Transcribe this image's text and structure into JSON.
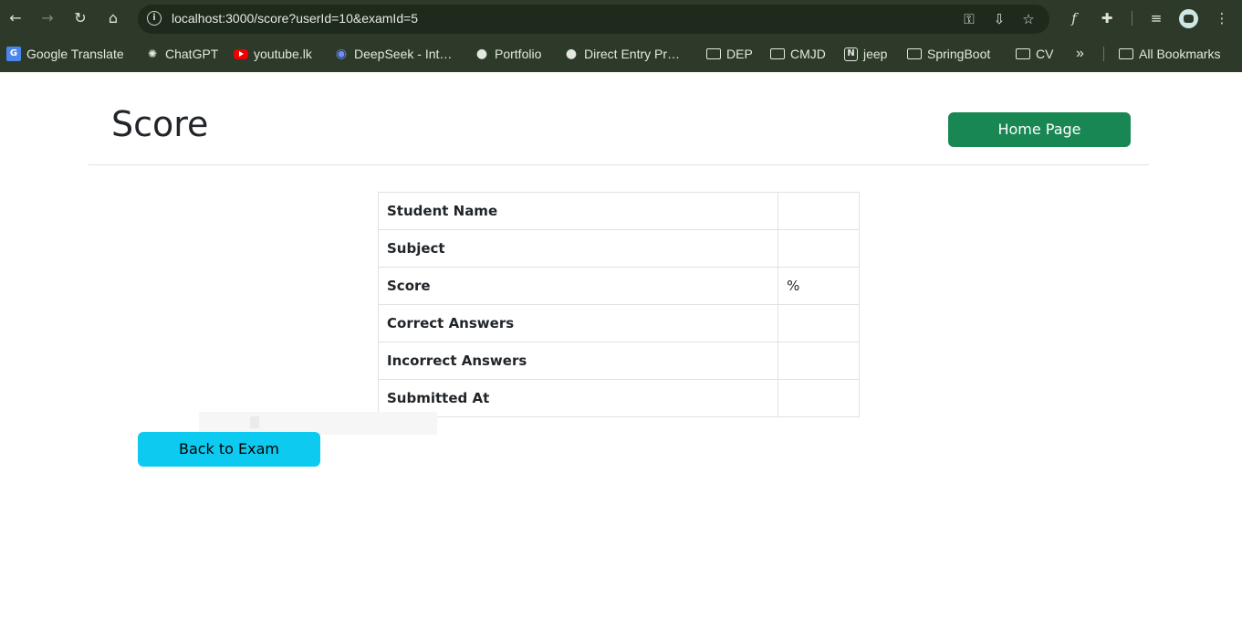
{
  "browser": {
    "url": "localhost:3000/score?userId=10&examId=5",
    "bookmarks": [
      {
        "label": "Google Translate",
        "icon": "google-translate-icon"
      },
      {
        "label": "ChatGPT",
        "icon": "chatgpt-icon"
      },
      {
        "label": "youtube.lk",
        "icon": "youtube-icon"
      },
      {
        "label": "DeepSeek - Int…",
        "icon": "deepseek-icon"
      },
      {
        "label": "Portfolio",
        "icon": "globe-icon"
      },
      {
        "label": "Direct Entry Pr…",
        "icon": "globe-icon"
      },
      {
        "label": "DEP",
        "icon": "folder-icon"
      },
      {
        "label": "CMJD",
        "icon": "folder-icon"
      },
      {
        "label": "jeep",
        "icon": "notion-icon"
      },
      {
        "label": "SpringBoot",
        "icon": "folder-icon"
      },
      {
        "label": "CV",
        "icon": "folder-icon"
      }
    ],
    "more_bookmarks": "»",
    "all_bookmarks": "All Bookmarks"
  },
  "page": {
    "title": "Score",
    "home_button": "Home Page",
    "back_button": "Back to Exam",
    "rows": [
      {
        "label": "Student Name",
        "value": ""
      },
      {
        "label": "Subject",
        "value": ""
      },
      {
        "label": "Score",
        "value": "%"
      },
      {
        "label": "Correct Answers",
        "value": ""
      },
      {
        "label": "Incorrect Answers",
        "value": ""
      },
      {
        "label": "Submitted At",
        "value": ""
      }
    ]
  },
  "colors": {
    "chrome_bg": "#2d3a2a",
    "omnibox_bg": "#1e2a1c",
    "success": "#198754",
    "info": "#0dcaf0",
    "border": "#dee2e6"
  }
}
